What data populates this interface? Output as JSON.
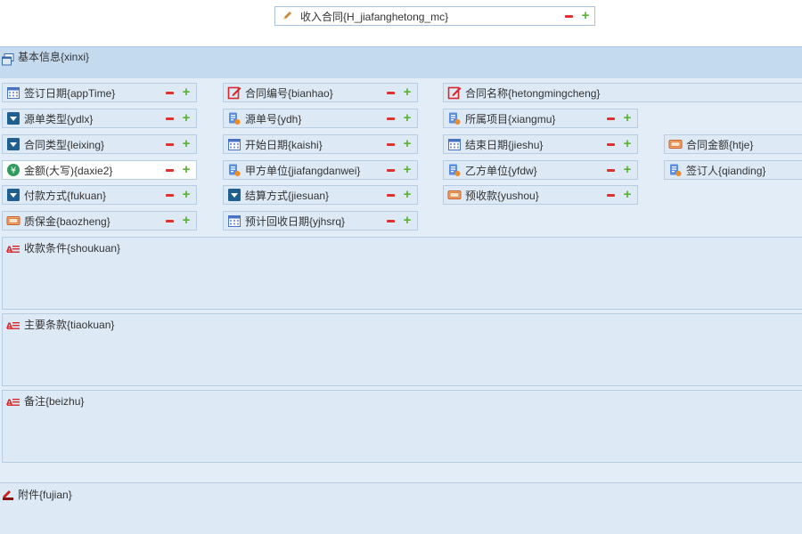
{
  "header": {
    "title_field": "收入合同{H_jiafanghetong_mc}"
  },
  "section": {
    "title": "基本信息{xinxi}"
  },
  "fields": {
    "appTime": "签订日期{appTime}",
    "bianhao": "合同编号{bianhao}",
    "hetongmingcheng": "合同名称{hetongmingcheng}",
    "ydlx": "源单类型{ydlx}",
    "ydh": "源单号{ydh}",
    "xiangmu": "所属项目{xiangmu}",
    "leixing": "合同类型{leixing}",
    "kaishi": "开始日期{kaishi}",
    "jieshu": "结束日期{jieshu}",
    "htje": "合同金额{htje}",
    "daxie2": "金额(大写){daxie2}",
    "jiafangdanwei": "甲方单位{jiafangdanwei}",
    "yfdw": "乙方单位{yfdw}",
    "qianding": "签订人{qianding}",
    "fukuan": "付款方式{fukuan}",
    "jiesuan": "结算方式{jiesuan}",
    "yushou": "预收款{yushou}",
    "baozheng": "质保金{baozheng}",
    "yjhsrq": "预计回收日期{yjhsrq}"
  },
  "textareas": {
    "shoukuan": "收款条件{shoukuan}",
    "tiaokuan": "主要条款{tiaokuan}",
    "beizhu": "备注{beizhu}"
  },
  "attachment": {
    "label": "附件{fujian}"
  },
  "icons": {
    "title": "pencil-icon",
    "section": "window-icon",
    "date": "calendar-icon",
    "edit": "edit-icon",
    "dropdown": "dropdown-icon",
    "doc": "document-icon",
    "money": "money-icon",
    "yen": "yen-icon",
    "textarea": "text-icon",
    "attach": "attachment-icon"
  },
  "colors": {
    "minus": "#e0302b",
    "plus": "#5bb132",
    "section_bg": "#c4daef",
    "field_bg": "#dde9f5"
  }
}
